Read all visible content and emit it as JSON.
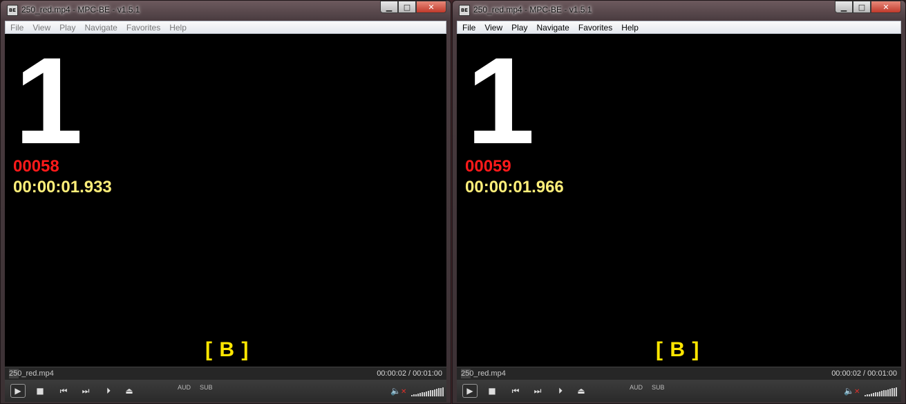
{
  "windows": [
    {
      "id": "left",
      "title": "250_red.mp4 - MPC-BE - v1.5.1",
      "app_icon_text": "BE",
      "menu": [
        "File",
        "View",
        "Play",
        "Navigate",
        "Favorites",
        "Help"
      ],
      "video": {
        "big_number": "1",
        "frame_number": "00058",
        "timecode": "00:00:01.933",
        "marker": "[ B ]"
      },
      "status": {
        "filename": "250_red.mp4",
        "time": "00:00:02 / 00:01:00"
      },
      "toolbar": {
        "play_glyph": "▶",
        "stop_glyph": "■",
        "prev_glyph": "⏮",
        "next_glyph": "⏭",
        "frame_step_glyph": "⏵",
        "eject_glyph": "⏏",
        "aud_label": "AUD",
        "sub_label": "SUB",
        "mute_glyph": "🔈",
        "mute_x": "✕"
      }
    },
    {
      "id": "right",
      "title": "250_red.mp4 - MPC-BE - v1.5.1",
      "app_icon_text": "BE",
      "menu": [
        "File",
        "View",
        "Play",
        "Navigate",
        "Favorites",
        "Help"
      ],
      "video": {
        "big_number": "1",
        "frame_number": "00059",
        "timecode": "00:00:01.966",
        "marker": "[ B ]"
      },
      "status": {
        "filename": "250_red.mp4",
        "time": "00:00:02 / 00:01:00"
      },
      "toolbar": {
        "play_glyph": "▶",
        "stop_glyph": "■",
        "prev_glyph": "⏮",
        "next_glyph": "⏭",
        "frame_step_glyph": "⏵",
        "eject_glyph": "⏏",
        "aud_label": "AUD",
        "sub_label": "SUB",
        "mute_glyph": "🔈",
        "mute_x": "✕"
      }
    }
  ],
  "window_controls": {
    "minimize": "▁",
    "maximize": "□",
    "close": "✕"
  },
  "colors": {
    "frame_number": "#ff1a1a",
    "timecode": "#ffef7a",
    "marker": "#ffe600",
    "close_button": "#c0392b"
  },
  "volume_level": 1.0
}
